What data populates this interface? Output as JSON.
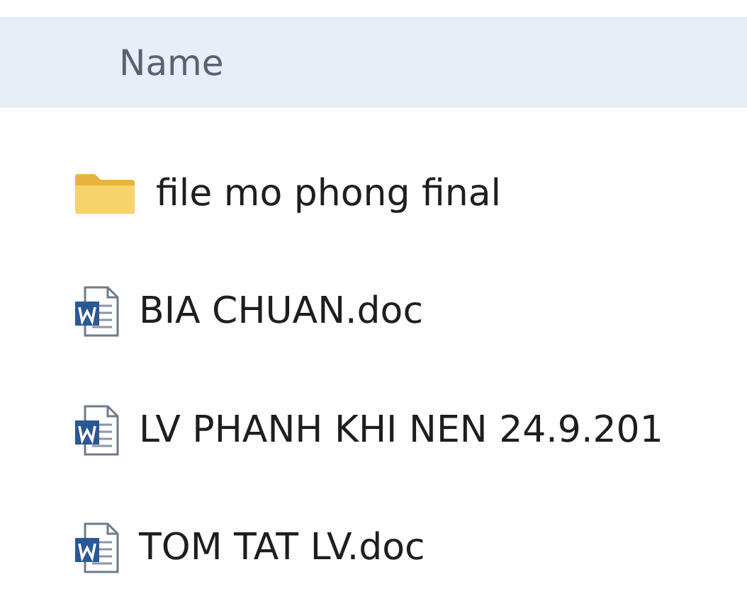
{
  "header": {
    "column_1": "Name"
  },
  "files": [
    {
      "name": "file mo phong final",
      "kind": "folder"
    },
    {
      "name": "BIA CHUAN.doc",
      "kind": "word"
    },
    {
      "name": "LV PHANH KHI NEN 24.9.201",
      "kind": "word"
    },
    {
      "name": "TOM TAT LV.doc",
      "kind": "word"
    }
  ]
}
